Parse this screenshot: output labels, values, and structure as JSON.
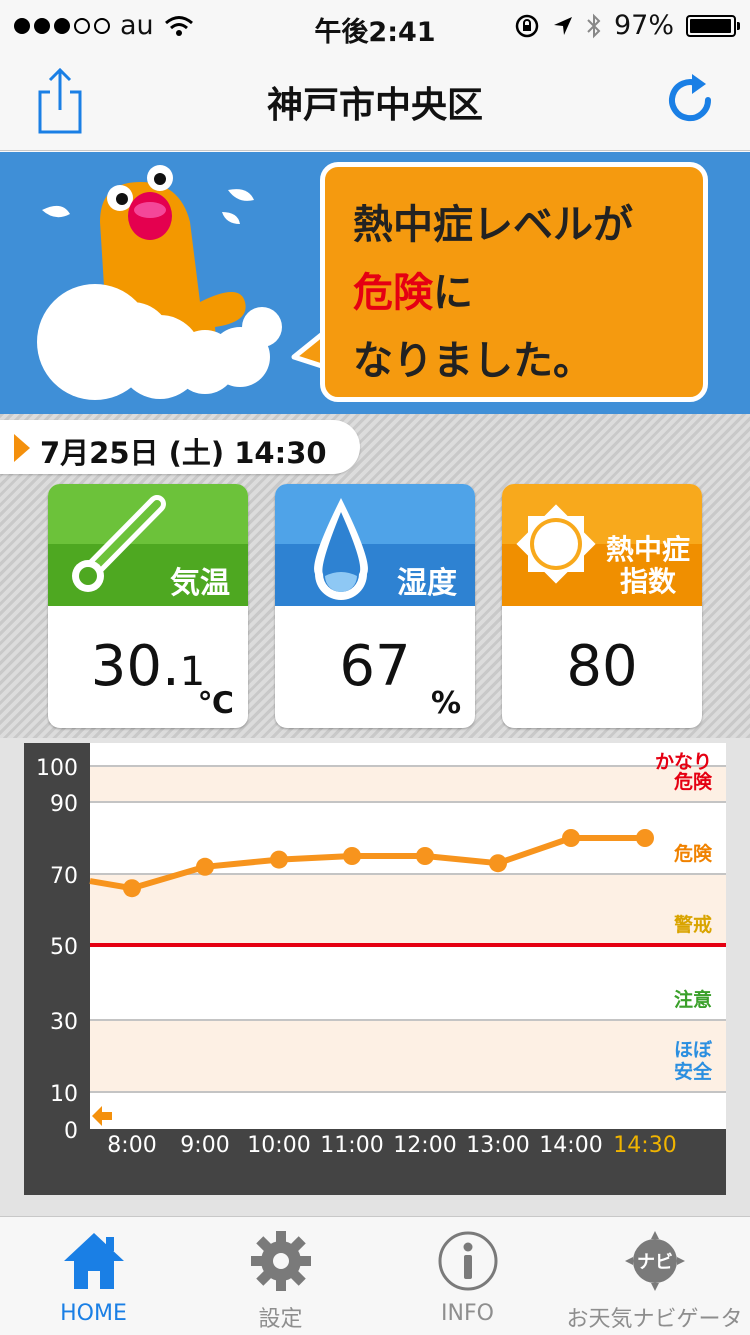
{
  "status_bar": {
    "carrier": "au",
    "time": "午後2:41",
    "battery": "97%",
    "battery_level": 0.97
  },
  "nav": {
    "title": "神戸市中央区",
    "share_icon": "share-icon",
    "refresh_icon": "refresh-icon"
  },
  "banner": {
    "line1": "熱中症レベルが",
    "danger_word": "危険",
    "line2_suffix": "に",
    "line3": "なりました。"
  },
  "date": {
    "text": "7月25日 (土) 14:30"
  },
  "cards": {
    "temperature": {
      "label": "気温",
      "value": "30.",
      "value_small": "1",
      "unit": "℃"
    },
    "humidity": {
      "label": "湿度",
      "value": "67",
      "unit": "%"
    },
    "heat_index": {
      "label_line1": "熱中症",
      "label_line2": "指数",
      "value": "80"
    }
  },
  "colors": {
    "accent_blue": "#1a7fe5",
    "orange": "#f4900c",
    "danger_red": "#e50012",
    "green": "#6cc23a"
  },
  "chart_data": {
    "type": "line",
    "categories": [
      "8:00",
      "9:00",
      "10:00",
      "11:00",
      "12:00",
      "13:00",
      "14:00",
      "14:30"
    ],
    "series": [
      {
        "values": [
          66,
          72,
          74,
          75,
          75,
          73,
          80,
          80
        ]
      }
    ],
    "y_ticks": [
      "100",
      "90",
      "70",
      "50",
      "30",
      "10",
      "0"
    ],
    "ylim": [
      0,
      100
    ],
    "threshold": 50,
    "zones": [
      {
        "label_line1": "かなり",
        "label_line2": "危険",
        "color": "#e50012"
      },
      {
        "label_line1": "危険",
        "label_line2": "",
        "color": "#f08200"
      },
      {
        "label_line1": "警戒",
        "label_line2": "",
        "color": "#d9a400"
      },
      {
        "label_line1": "注意",
        "label_line2": "",
        "color": "#3aa02a"
      },
      {
        "label_line1": "ほぼ",
        "label_line2": "安全",
        "color": "#2b8fe0"
      }
    ],
    "line_color": "#f7941d",
    "highlight_category_color": "#f0b400"
  },
  "tabs": [
    {
      "label": "HOME",
      "icon": "home-icon",
      "active": true
    },
    {
      "label": "設定",
      "icon": "gear-icon",
      "active": false
    },
    {
      "label": "INFO",
      "icon": "info-icon",
      "active": false
    },
    {
      "label": "お天気ナビゲータ",
      "icon": "navi-icon",
      "icon_text": "ナビ",
      "active": false
    }
  ]
}
